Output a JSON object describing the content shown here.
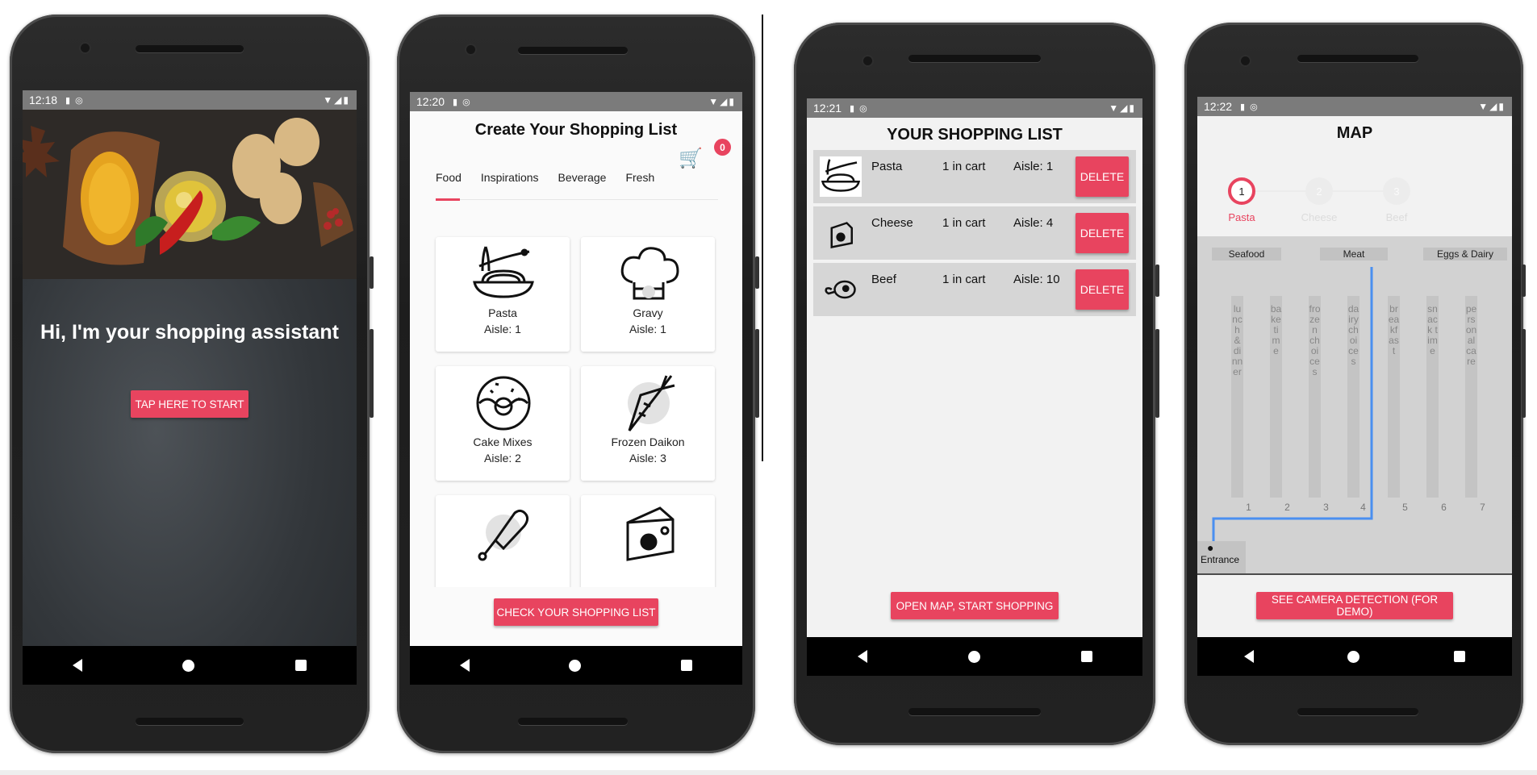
{
  "screens": [
    {
      "id": "welcome",
      "status_time": "12:18",
      "hero_title": "Hi, I'm your shopping assistant",
      "start_button": "TAP HERE TO START"
    },
    {
      "id": "create-list",
      "status_time": "12:20",
      "title": "Create Your Shopping List",
      "cart_count": "0",
      "tabs": [
        "Food",
        "Inspirations",
        "Beverage",
        "Fresh"
      ],
      "active_tab": "Food",
      "products": [
        {
          "name": "Pasta",
          "aisle": "Aisle: 1",
          "icon": "pasta-icon"
        },
        {
          "name": "Gravy",
          "aisle": "Aisle: 1",
          "icon": "chef-hat-icon"
        },
        {
          "name": "Cake Mixes",
          "aisle": "Aisle: 2",
          "icon": "donut-icon"
        },
        {
          "name": "Frozen Daikon",
          "aisle": "Aisle: 3",
          "icon": "carrot-icon"
        },
        {
          "name": "",
          "aisle": "",
          "icon": "ice-cream-icon"
        },
        {
          "name": "",
          "aisle": "",
          "icon": "cheese-icon"
        }
      ],
      "check_button": "CHECK YOUR SHOPPING LIST"
    },
    {
      "id": "shopping-list",
      "status_time": "12:21",
      "title": "YOUR SHOPPING LIST",
      "items": [
        {
          "name": "Pasta",
          "qty": "1 in cart",
          "aisle": "Aisle: 1",
          "icon": "pasta-icon"
        },
        {
          "name": "Cheese",
          "qty": "1 in cart",
          "aisle": "Aisle: 4",
          "icon": "cheese-icon"
        },
        {
          "name": "Beef",
          "qty": "1 in cart",
          "aisle": "Aisle: 10",
          "icon": "meat-icon"
        }
      ],
      "delete_label": "DELETE",
      "open_map_button": "OPEN MAP, START SHOPPING"
    },
    {
      "id": "map",
      "status_time": "12:22",
      "title": "MAP",
      "steps": [
        {
          "number": "1",
          "label": "Pasta",
          "active": true
        },
        {
          "number": "2",
          "label": "Cheese",
          "active": false
        },
        {
          "number": "3",
          "label": "Beef",
          "active": false
        }
      ],
      "sections": [
        "Seafood",
        "Meat",
        "Eggs & Dairy"
      ],
      "aisles": [
        {
          "label": "lunch & dinner",
          "number": "1"
        },
        {
          "label": "bake time",
          "number": "2"
        },
        {
          "label": "frozen choices",
          "number": "3"
        },
        {
          "label": "dairy choices",
          "number": "4"
        },
        {
          "label": "breakfast",
          "number": "5"
        },
        {
          "label": "snack time",
          "number": "6"
        },
        {
          "label": "personal care",
          "number": "7"
        }
      ],
      "entrance_label": "Entrance",
      "camera_button": "SEE CAMERA DETECTION (FOR DEMO)"
    }
  ],
  "colors": {
    "accent": "#e8445f",
    "statusbar": "#7b7b7b",
    "route": "#4a8ff0"
  }
}
